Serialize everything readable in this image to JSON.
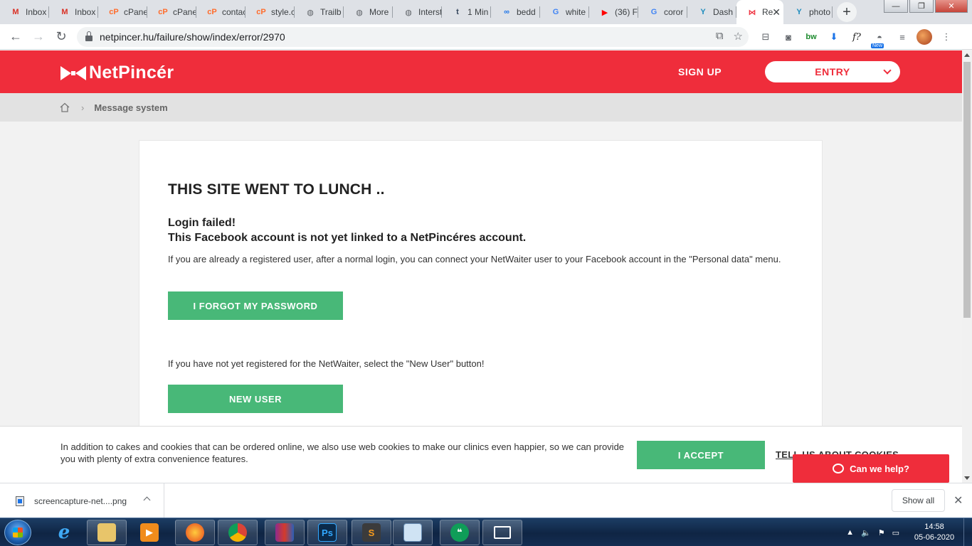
{
  "browser": {
    "tabs": [
      {
        "title": "Inbox",
        "icon": "gmail-icon",
        "color": "#d93025",
        "glyph": "M"
      },
      {
        "title": "Inbox",
        "icon": "gmail-icon",
        "color": "#d93025",
        "glyph": "M"
      },
      {
        "title": "cPanel",
        "icon": "cpanel-icon",
        "color": "#ff6c2c",
        "glyph": "cP"
      },
      {
        "title": "cPanel",
        "icon": "cpanel-icon",
        "color": "#ff6c2c",
        "glyph": "cP"
      },
      {
        "title": "contact",
        "icon": "cpanel-icon",
        "color": "#ff6c2c",
        "glyph": "cP"
      },
      {
        "title": "style.c",
        "icon": "cpanel-icon",
        "color": "#ff6c2c",
        "glyph": "cP"
      },
      {
        "title": "Trailb",
        "icon": "globe-icon",
        "color": "#5f6368",
        "glyph": "◍"
      },
      {
        "title": "More",
        "icon": "globe-icon",
        "color": "#5f6368",
        "glyph": "◍"
      },
      {
        "title": "Interst",
        "icon": "globe-icon",
        "color": "#5f6368",
        "glyph": "◍"
      },
      {
        "title": "1 Min",
        "icon": "tumblr-icon",
        "color": "#35465c",
        "glyph": "t"
      },
      {
        "title": "bedd",
        "icon": "infinity-icon",
        "color": "#1a73e8",
        "glyph": "∞"
      },
      {
        "title": "white",
        "icon": "google-icon",
        "color": "#4285f4",
        "glyph": "G"
      },
      {
        "title": "(36) F",
        "icon": "youtube-icon",
        "color": "#ff0000",
        "glyph": "▶"
      },
      {
        "title": "coror",
        "icon": "google-icon",
        "color": "#4285f4",
        "glyph": "G"
      },
      {
        "title": "Dash",
        "icon": "yoast-icon",
        "color": "#1e8cbe",
        "glyph": "Y"
      },
      {
        "title": "Re",
        "icon": "netpincer-icon",
        "color": "#ef2d3b",
        "glyph": "⋈",
        "active": true
      },
      {
        "title": "photo",
        "icon": "yoast-icon",
        "color": "#1e8cbe",
        "glyph": "Y"
      }
    ],
    "url": "netpincer.hu/failure/show/index/error/2970"
  },
  "site": {
    "brand": "NetPincér",
    "signup_label": "SIGN UP",
    "entry_label": "ENTRY",
    "breadcrumb_label": "Message system"
  },
  "card": {
    "heading": "THIS SITE WENT TO LUNCH ..",
    "fail_line1": "Login failed!",
    "fail_line2": "This Facebook account is not yet linked to a NetPincéres account.",
    "note1": "If you are already a registered user, after a normal login, you can connect your NetWaiter user to your Facebook account in the \"Personal data\" menu.",
    "forgot_label": "I FORGOT MY PASSWORD",
    "note2": "If you have not yet registered for the NetWaiter, select the \"New User\" button!",
    "newuser_label": "NEW USER"
  },
  "cookie": {
    "text": "In addition to cakes and cookies that can be ordered online, we also use web cookies to make our clinics even happier, so we can provide you with plenty of extra convenience features.",
    "accept_label": "I ACCEPT",
    "tellus_label": "TELL US ABOUT COOKIES"
  },
  "help_label": "Can we help?",
  "download": {
    "filename": "screencapture-net....png",
    "show_all_label": "Show all"
  },
  "taskbar": {
    "time": "14:58",
    "date": "05-06-2020"
  },
  "colors": {
    "brand_red": "#ef2d3b",
    "action_green": "#48b878"
  }
}
